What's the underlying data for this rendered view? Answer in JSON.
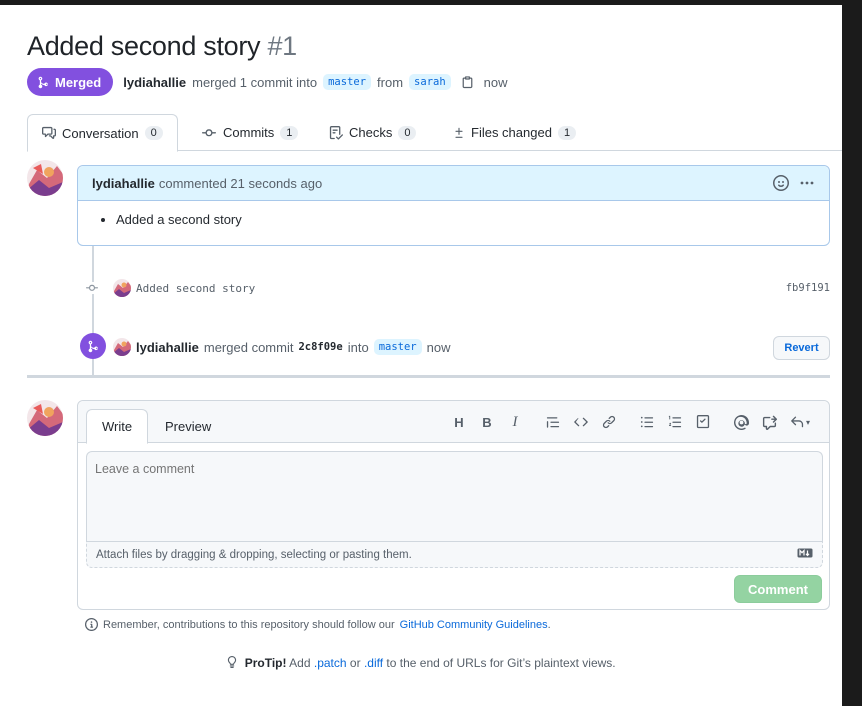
{
  "pr": {
    "title": "Added second story",
    "number": "#1",
    "state": "Merged",
    "author": "lydiahallie",
    "merge_text": "merged 1 commit into",
    "base_branch": "master",
    "from_text": "from",
    "head_branch": "sarah",
    "time": "now"
  },
  "tabs": [
    {
      "label": "Conversation",
      "count": "0",
      "icon": "comment-icon"
    },
    {
      "label": "Commits",
      "count": "1",
      "icon": "commit-icon"
    },
    {
      "label": "Checks",
      "count": "0",
      "icon": "checklist-icon"
    },
    {
      "label": "Files changed",
      "count": "1",
      "icon": "diff-icon"
    }
  ],
  "comment": {
    "author": "lydiahallie",
    "meta": "commented 21 seconds ago",
    "bullet": "Added a second story"
  },
  "commit": {
    "message": "Added second story",
    "sha": "fb9f191"
  },
  "merge_event": {
    "author": "lydiahallie",
    "text": "merged commit",
    "hash": "2c8f09e",
    "into": "into",
    "branch": "master",
    "time": "now",
    "revert_label": "Revert"
  },
  "editor": {
    "tab_write": "Write",
    "tab_preview": "Preview",
    "placeholder": "Leave a comment",
    "attach_text": "Attach files by dragging & dropping, selecting or pasting them.",
    "markdown_badge": "MD",
    "submit_label": "Comment"
  },
  "footer": {
    "guidelines_prefix": "Remember, contributions to this repository should follow our",
    "guidelines_link": "GitHub Community Guidelines",
    "guidelines_suffix": ".",
    "protip_label": "ProTip!",
    "protip_add": "Add",
    "protip_patch": ".patch",
    "protip_or": "or",
    "protip_diff": ".diff",
    "protip_rest": "to the end of URLs for Git’s plaintext views."
  },
  "colors": {
    "merged": "#8250df",
    "link": "#0969da",
    "comment_header": "#ddf4ff",
    "submit_disabled": "#94d3a2"
  }
}
